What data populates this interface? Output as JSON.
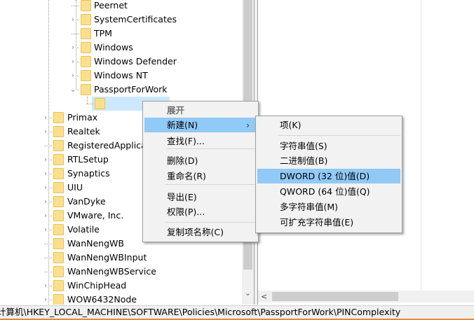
{
  "tree": {
    "inner_items": [
      {
        "label": "Peernet",
        "expander": false
      },
      {
        "label": "SystemCertificates",
        "expander": true
      },
      {
        "label": "TPM",
        "expander": false
      },
      {
        "label": "Windows",
        "expander": true
      },
      {
        "label": "Windows Defender",
        "expander": true
      },
      {
        "label": "Windows NT",
        "expander": true
      },
      {
        "label": "PassportForWork",
        "expander": "open"
      }
    ],
    "selected_item": "PINCom",
    "outer_items": [
      {
        "label": "Primax",
        "expander": true
      },
      {
        "label": "Realtek",
        "expander": true
      },
      {
        "label": "RegisteredApplica",
        "expander": false
      },
      {
        "label": "RTLSetup",
        "expander": true
      },
      {
        "label": "Synaptics",
        "expander": true
      },
      {
        "label": "UIU",
        "expander": true
      },
      {
        "label": "VanDyke",
        "expander": true
      },
      {
        "label": "VMware, Inc.",
        "expander": true
      },
      {
        "label": "Volatile",
        "expander": true
      },
      {
        "label": "WanNengWB",
        "expander": false
      },
      {
        "label": "WanNengWBInput",
        "expander": false
      },
      {
        "label": "WanNengWBService",
        "expander": false
      },
      {
        "label": "WinChipHead",
        "expander": true
      },
      {
        "label": "WOW6432Node",
        "expander": true
      }
    ]
  },
  "context_menu": {
    "items": [
      "展开",
      "新建(N)",
      "查找(F)...",
      "删除(D)",
      "重命名(R)",
      "导出(E)",
      "权限(P)...",
      "复制项名称(C)"
    ],
    "submenu_arrow": "›"
  },
  "submenu": {
    "items": [
      "项(K)",
      "字符串值(S)",
      "二进制值(B)",
      "DWORD (32 位)值(D)",
      "QWORD (64 位)值(Q)",
      "多字符串值(M)",
      "可扩充字符串值(E)"
    ]
  },
  "scroll": {
    "down": "⌄",
    "left": "<"
  },
  "status_bar": {
    "path": "计算机\\HKEY_LOCAL_MACHINE\\SOFTWARE\\Policies\\Microsoft\\PassportForWork\\PINComplexity"
  }
}
